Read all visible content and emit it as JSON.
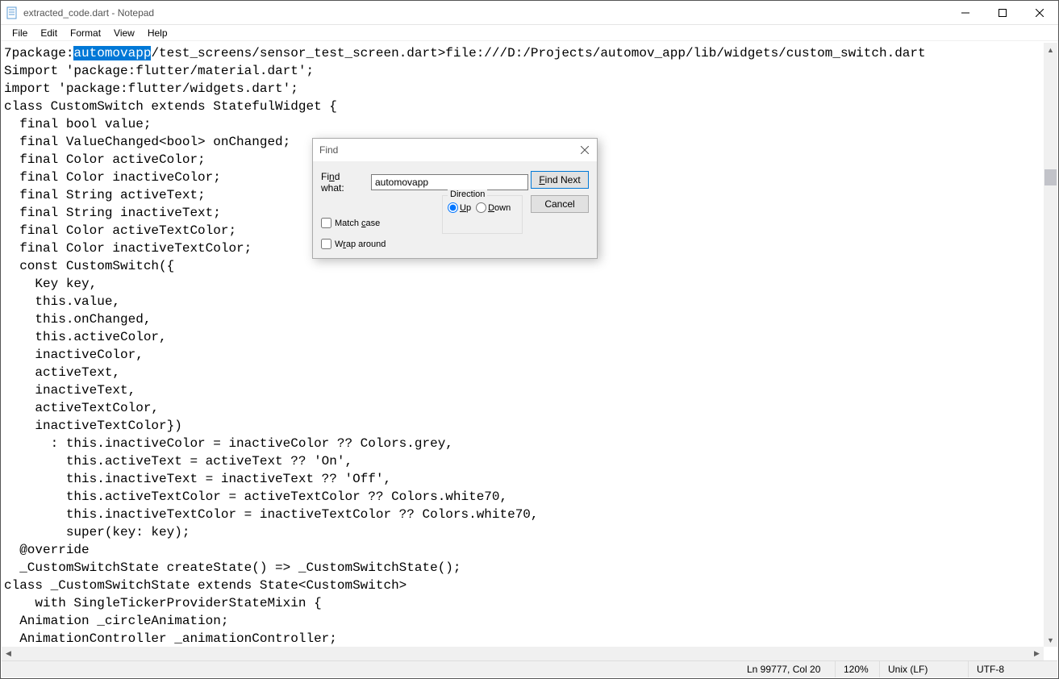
{
  "window": {
    "title": "extracted_code.dart - Notepad"
  },
  "menu": {
    "file": "File",
    "edit": "Edit",
    "format": "Format",
    "view": "View",
    "help": "Help"
  },
  "editor": {
    "line1_pre": "7package:",
    "line1_sel": "automovapp",
    "line1_post": "/test_screens/sensor_test_screen.dart>file:///D:/Projects/automov_app/lib/widgets/custom_switch.dart",
    "lines": [
      "Simport 'package:flutter/material.dart';",
      "import 'package:flutter/widgets.dart';",
      "class CustomSwitch extends StatefulWidget {",
      "  final bool value;",
      "  final ValueChanged<bool> onChanged;",
      "  final Color activeColor;",
      "  final Color inactiveColor;",
      "  final String activeText;",
      "  final String inactiveText;",
      "  final Color activeTextColor;",
      "  final Color inactiveTextColor;",
      "  const CustomSwitch({",
      "    Key key,",
      "    this.value,",
      "    this.onChanged,",
      "    this.activeColor,",
      "    inactiveColor,",
      "    activeText,",
      "    inactiveText,",
      "    activeTextColor,",
      "    inactiveTextColor})",
      "      : this.inactiveColor = inactiveColor ?? Colors.grey,",
      "        this.activeText = activeText ?? 'On',",
      "        this.inactiveText = inactiveText ?? 'Off',",
      "        this.activeTextColor = activeTextColor ?? Colors.white70,",
      "        this.inactiveTextColor = inactiveTextColor ?? Colors.white70,",
      "        super(key: key);",
      "  @override",
      "  _CustomSwitchState createState() => _CustomSwitchState();",
      "class _CustomSwitchState extends State<CustomSwitch>",
      "    with SingleTickerProviderStateMixin {",
      "  Animation _circleAnimation;",
      "  AnimationController _animationController;"
    ]
  },
  "find": {
    "title": "Find",
    "what_label": "Find what:",
    "what_value": "automovapp",
    "find_next": "Find Next",
    "cancel": "Cancel",
    "direction": "Direction",
    "up": "Up",
    "down": "Down",
    "match_case": "Match case",
    "wrap_around": "Wrap around"
  },
  "status": {
    "position": "Ln 99777, Col 20",
    "zoom": "120%",
    "eol": "Unix (LF)",
    "encoding": "UTF-8"
  }
}
